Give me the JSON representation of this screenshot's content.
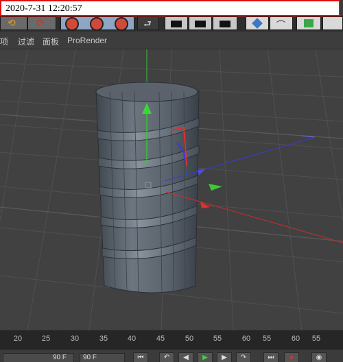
{
  "timestamp": "2020-7-31  12:20:57",
  "menu": {
    "items": [
      {
        "label": "项"
      },
      {
        "label": "过滤"
      },
      {
        "label": "面板"
      },
      {
        "label": "ProRender"
      }
    ]
  },
  "timeline": {
    "ticks": [
      "20",
      "25",
      "30",
      "35",
      "40",
      "45",
      "50",
      "55",
      "60",
      "55",
      "60",
      "55"
    ]
  },
  "playback": {
    "start_frame": "90 F",
    "end_frame": "90 F"
  },
  "icons": [
    "undo-icon",
    "redo-icon",
    "x-axis-icon",
    "y-axis-icon",
    "z-axis-icon",
    "coordinate-icon",
    "render-icon",
    "cube-icon",
    "bend-icon",
    "scene-icon",
    "goto-start-icon",
    "prev-key-icon",
    "play-icon",
    "next-key-icon",
    "goto-end-icon",
    "record-icon"
  ]
}
